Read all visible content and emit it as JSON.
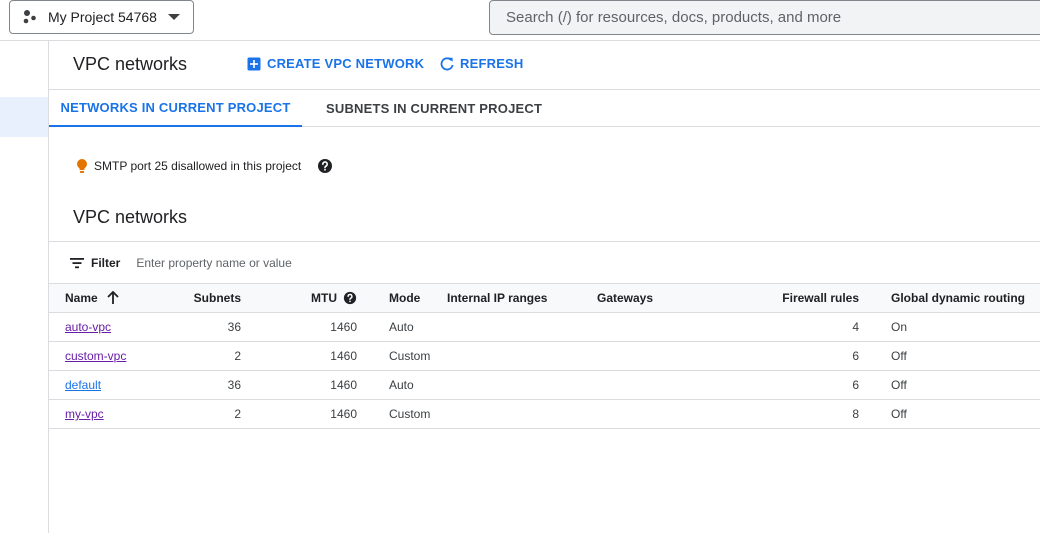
{
  "topbar": {
    "project_name": "My Project 54768",
    "search_placeholder": "Search (/) for resources, docs, products, and more"
  },
  "header": {
    "title": "VPC networks",
    "create_label": "CREATE VPC NETWORK",
    "refresh_label": "REFRESH"
  },
  "tabs": [
    {
      "label": "NETWORKS IN CURRENT PROJECT",
      "active": true
    },
    {
      "label": "SUBNETS IN CURRENT PROJECT",
      "active": false
    }
  ],
  "notice": {
    "text": "SMTP port 25 disallowed in this project"
  },
  "section": {
    "title": "VPC networks"
  },
  "filter": {
    "label": "Filter",
    "placeholder": "Enter property name or value"
  },
  "table": {
    "columns": [
      "Name",
      "Subnets",
      "MTU",
      "Mode",
      "Internal IP ranges",
      "Gateways",
      "Firewall rules",
      "Global dynamic routing"
    ],
    "rows": [
      {
        "name": "auto-vpc",
        "subnets": "36",
        "mtu": "1460",
        "mode": "Auto",
        "ip_ranges": "",
        "gateways": "",
        "firewall_rules": "4",
        "routing": "On"
      },
      {
        "name": "custom-vpc",
        "subnets": "2",
        "mtu": "1460",
        "mode": "Custom",
        "ip_ranges": "",
        "gateways": "",
        "firewall_rules": "6",
        "routing": "Off"
      },
      {
        "name": "default",
        "subnets": "36",
        "mtu": "1460",
        "mode": "Auto",
        "ip_ranges": "",
        "gateways": "",
        "firewall_rules": "6",
        "routing": "Off"
      },
      {
        "name": "my-vpc",
        "subnets": "2",
        "mtu": "1460",
        "mode": "Custom",
        "ip_ranges": "",
        "gateways": "",
        "firewall_rules": "8",
        "routing": "Off"
      }
    ]
  },
  "colors": {
    "accent": "#1a73e8",
    "visited_link": "#681da8",
    "notice_icon": "#e37400"
  },
  "icons": {
    "project": "project-dots-icon",
    "create": "add-box-icon",
    "refresh": "refresh-icon",
    "notice": "lightbulb-icon",
    "help": "help-icon",
    "filter": "filter-icon",
    "sort": "arrow-up-icon"
  }
}
